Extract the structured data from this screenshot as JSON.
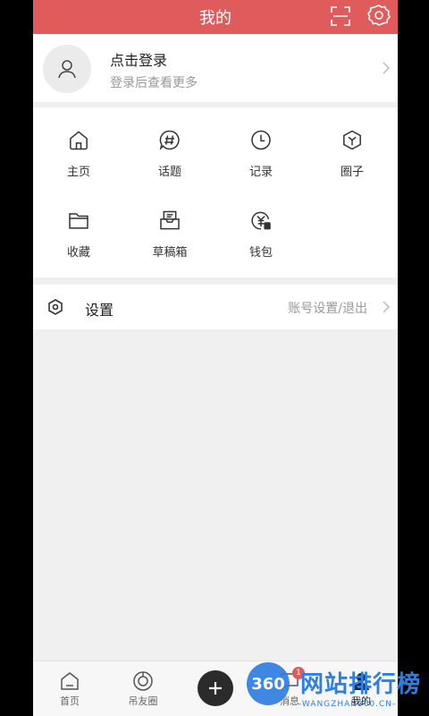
{
  "header": {
    "title": "我的"
  },
  "login": {
    "title": "点击登录",
    "subtitle": "登录后查看更多"
  },
  "grid": [
    {
      "label": "主页",
      "icon": "home-icon"
    },
    {
      "label": "话题",
      "icon": "hashtag-icon"
    },
    {
      "label": "记录",
      "icon": "clock-icon"
    },
    {
      "label": "圈子",
      "icon": "cube-icon"
    },
    {
      "label": "收藏",
      "icon": "folder-icon"
    },
    {
      "label": "草稿箱",
      "icon": "draft-box-icon"
    },
    {
      "label": "钱包",
      "icon": "wallet-icon"
    }
  ],
  "settings": {
    "label": "设置",
    "value": "账号设置/退出"
  },
  "tabbar": {
    "items": [
      {
        "label": "首页",
        "icon": "home-tab-icon"
      },
      {
        "label": "吊友圈",
        "icon": "circle-tab-icon"
      },
      {
        "label": "消息",
        "icon": "message-tab-icon"
      },
      {
        "label": "我的",
        "icon": "me-tab-icon"
      }
    ],
    "badge": "1"
  },
  "watermark": {
    "number": "360",
    "text": "网站排行榜",
    "sub": "-WANGZHAN360.CN-"
  },
  "colors": {
    "accent": "#e05b5b",
    "watermark": "#2f7fe0"
  }
}
